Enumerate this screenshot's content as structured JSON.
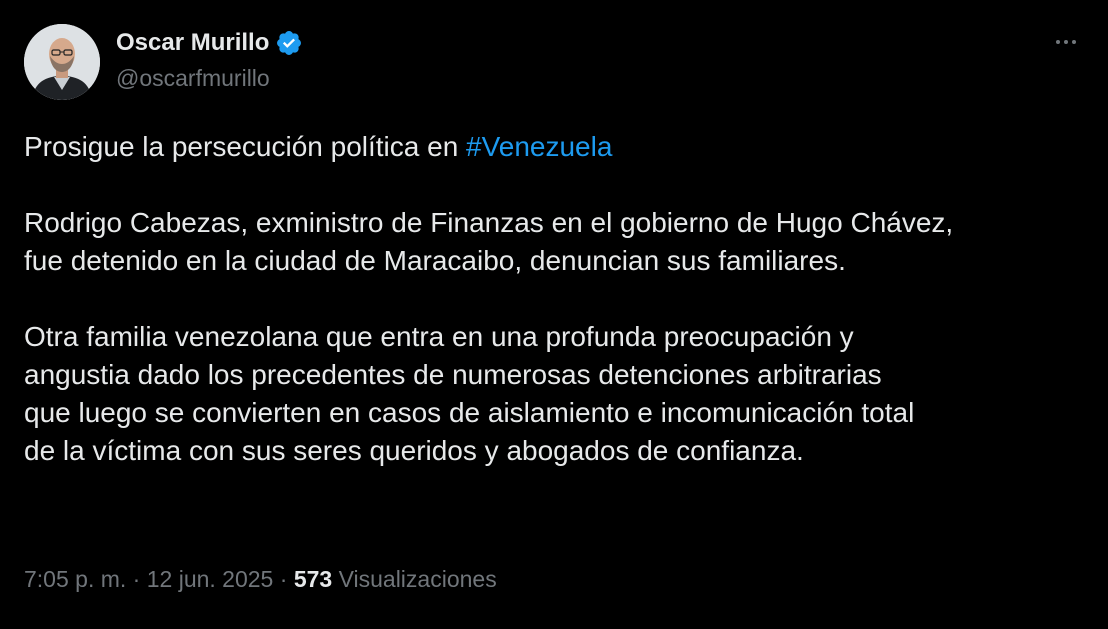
{
  "author": {
    "display_name": "Oscar Murillo",
    "handle": "@oscarfmurillo",
    "verified": true
  },
  "tweet": {
    "line1_prefix": "Prosigue la persecución política en ",
    "hashtag": "#Venezuela",
    "para2_line1": "Rodrigo Cabezas, exministro de Finanzas en el gobierno de Hugo Chávez,",
    "para2_line2": "fue detenido en la ciudad de Maracaibo, denuncian sus familiares.",
    "para3_line1": "Otra familia venezolana que entra en una profunda preocupación y",
    "para3_line2": "angustia dado los precedentes de numerosas detenciones arbitrarias",
    "para3_line3": "que luego se convierten en casos de aislamiento e incomunicación total",
    "para3_line4": "de la víctima con sus seres queridos y abogados de confianza."
  },
  "meta": {
    "time": "7:05 p. m.",
    "separator": " · ",
    "date": "12 jun. 2025",
    "views_count": "573",
    "views_label": " Visualizaciones"
  },
  "icons": {
    "verified": "verified-badge-icon",
    "more": "more-options-icon"
  },
  "colors": {
    "background": "#000000",
    "text": "#e7e9ea",
    "secondary": "#71767b",
    "accent": "#1d9bf0"
  }
}
